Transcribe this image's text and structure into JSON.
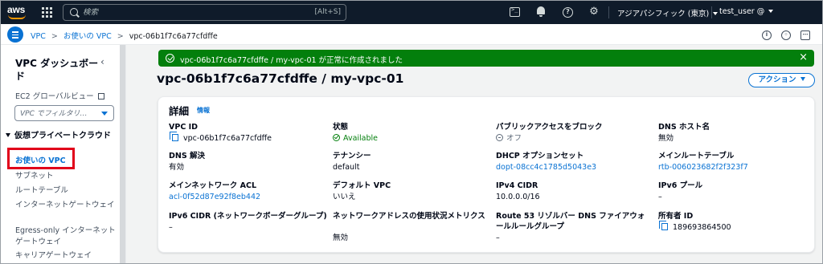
{
  "topnav": {
    "logo_text": "aws",
    "search_placeholder": "検索",
    "search_shortcut": "[Alt+S]",
    "region": "アジアパシフィック (東京)",
    "user": "test_user @",
    "icons": [
      "grid-icon",
      "search-icon",
      "cloudshell-icon",
      "bell-icon",
      "help-icon",
      "gear-icon"
    ]
  },
  "breadcrumb": {
    "items": [
      "VPC",
      "お使いの VPC"
    ],
    "current": "vpc-06b1f7c6a77cfdffe",
    "right_icons": [
      "info-icon",
      "settings-icon",
      "feedback-icon"
    ]
  },
  "sidebar": {
    "title": "VPC ダッシュボード",
    "ec2_global": "EC2 グローバルビュー",
    "filter_placeholder": "VPC でフィルタリ…",
    "section": "仮想プライベートクラウド",
    "items": [
      {
        "label": "お使いの VPC",
        "active": true
      },
      {
        "label": "サブネット",
        "active": false
      },
      {
        "label": "ルートテーブル",
        "active": false
      },
      {
        "label": "インターネットゲートウェイ",
        "active": false
      },
      {
        "label": "Egress-only インターネットゲートウェイ",
        "active": false
      },
      {
        "label": "キャリアゲートウェイ",
        "active": false
      }
    ]
  },
  "flash": {
    "message": "vpc-06b1f7c6a77cfdffe / my-vpc-01 が正常に作成されました",
    "close": "×",
    "color": "#037f0c"
  },
  "page": {
    "title": "vpc-06b1f7c6a77cfdffe / my-vpc-01",
    "action_label": "アクション"
  },
  "details": {
    "title": "詳細",
    "info": "情報",
    "fields": {
      "vpc_id": {
        "label": "VPC ID",
        "value": "vpc-06b1f7c6a77cfdffe"
      },
      "state": {
        "label": "状態",
        "value": "Available"
      },
      "public_access": {
        "label": "パブリックアクセスをブロック",
        "value": "オフ"
      },
      "dns_hostnames": {
        "label": "DNS ホスト名",
        "value": "無効"
      },
      "dns_resolution": {
        "label": "DNS 解決",
        "value": "有効"
      },
      "tenancy": {
        "label": "テナンシー",
        "value": "default"
      },
      "dhcp": {
        "label": "DHCP オプションセット",
        "value": "dopt-08cc4c1785d5043e3"
      },
      "main_route_table": {
        "label": "メインルートテーブル",
        "value": "rtb-006023682f2f323f7"
      },
      "main_acl": {
        "label": "メインネットワーク ACL",
        "value": "acl-0f52d87e92f8eb442"
      },
      "default_vpc": {
        "label": "デフォルト VPC",
        "value": "いいえ"
      },
      "ipv4_cidr": {
        "label": "IPv4 CIDR",
        "value": "10.0.0.0/16"
      },
      "ipv6_pool": {
        "label": "IPv6 プール",
        "value": "–"
      },
      "ipv6_cidr": {
        "label": "IPv6 CIDR (ネットワークボーダーグループ)",
        "value": "–"
      },
      "net_addr_metrics": {
        "label": "ネットワークアドレスの使用状況メトリクス",
        "value": "無効"
      },
      "route53": {
        "label": "Route 53 リゾルバー DNS ファイアウォールルールグループ",
        "value": "–"
      },
      "owner_id": {
        "label": "所有者 ID",
        "value": "189693864500"
      }
    }
  },
  "colors": {
    "nav_bg": "#0f1b2a",
    "link": "#0972d3",
    "success": "#037f0c",
    "highlight_box": "#e1001a",
    "content_bg": "#f2f3f3"
  }
}
